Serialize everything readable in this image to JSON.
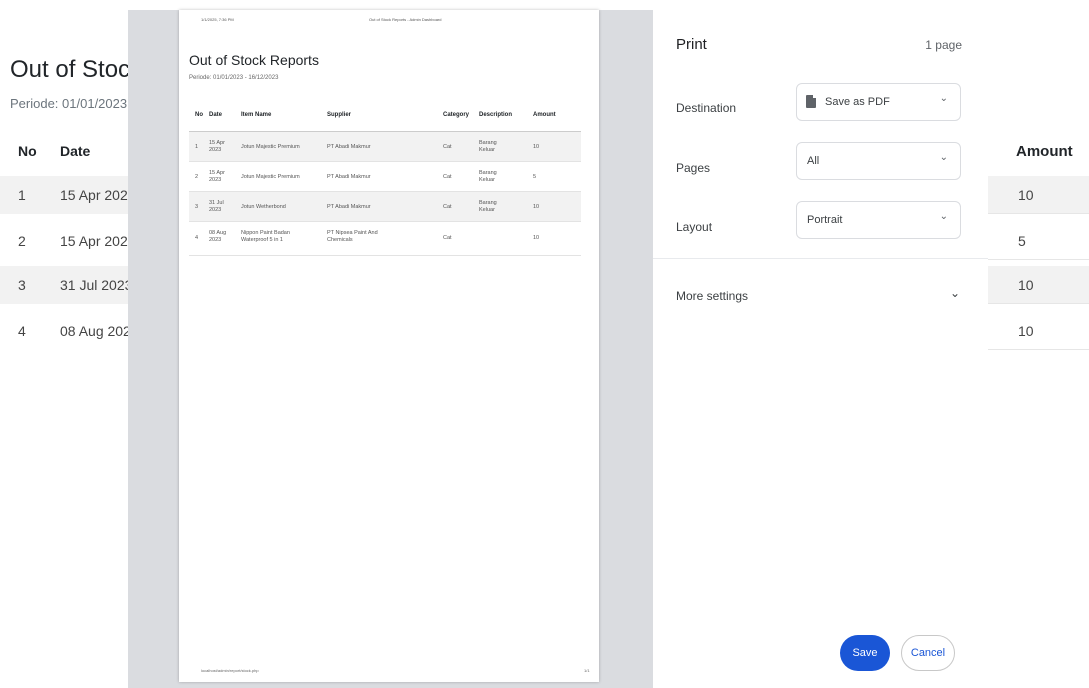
{
  "background": {
    "title": "Out of Stoc",
    "periode": "Periode: 01/01/2023",
    "headers": {
      "no": "No",
      "date": "Date",
      "amount": "Amount"
    },
    "rows": [
      {
        "no": "1",
        "date": "15 Apr 202",
        "amount": "10"
      },
      {
        "no": "2",
        "date": "15 Apr 202",
        "amount": "5"
      },
      {
        "no": "3",
        "date": "31 Jul 2023",
        "amount": "10"
      },
      {
        "no": "4",
        "date": "08 Aug 202",
        "amount": "10"
      }
    ]
  },
  "preview": {
    "meta_left": "1/1/2025, 7:36 PM",
    "meta_center": "Out of Stock Reports - Admin Dashboard",
    "title": "Out of Stock Reports",
    "periode": "Periode: 01/01/2023 - 16/12/2023",
    "headers": {
      "no": "No",
      "date": "Date",
      "item": "Item Name",
      "supplier": "Supplier",
      "category": "Category",
      "description": "Description",
      "amount": "Amount"
    },
    "rows": [
      {
        "no": "1",
        "date": "15 Apr 2023",
        "item": "Jotun Majestic Premium",
        "supplier": "PT Abadi Makmur",
        "category": "Cat",
        "description": "Barang Keluar",
        "amount": "10"
      },
      {
        "no": "2",
        "date": "15 Apr 2023",
        "item": "Jotun Majestic Premium",
        "supplier": "PT Abadi Makmur",
        "category": "Cat",
        "description": "Barang Keluar",
        "amount": "5"
      },
      {
        "no": "3",
        "date": "31 Jul 2023",
        "item": "Jotun Wetherbond",
        "supplier": "PT Abadi Makmur",
        "category": "Cat",
        "description": "Barang Keluar",
        "amount": "10"
      },
      {
        "no": "4",
        "date": "08 Aug 2023",
        "item": "Nippon Paint Badan Waterproof 5 in 1",
        "supplier": "PT Nipsea Paint And Chemicals",
        "category": "Cat",
        "description": "",
        "amount": "10"
      }
    ],
    "footer_left": "localhost/admin/report/stock.php",
    "footer_right": "1/1"
  },
  "settings": {
    "title": "Print",
    "page_count": "1 page",
    "destination_label": "Destination",
    "destination_value": "Save as PDF",
    "destination_icon": "pdf-file-icon",
    "pages_label": "Pages",
    "pages_value": "All",
    "layout_label": "Layout",
    "layout_value": "Portrait",
    "more_settings_label": "More settings",
    "save_label": "Save",
    "cancel_label": "Cancel",
    "accent": "#1a56d6"
  }
}
